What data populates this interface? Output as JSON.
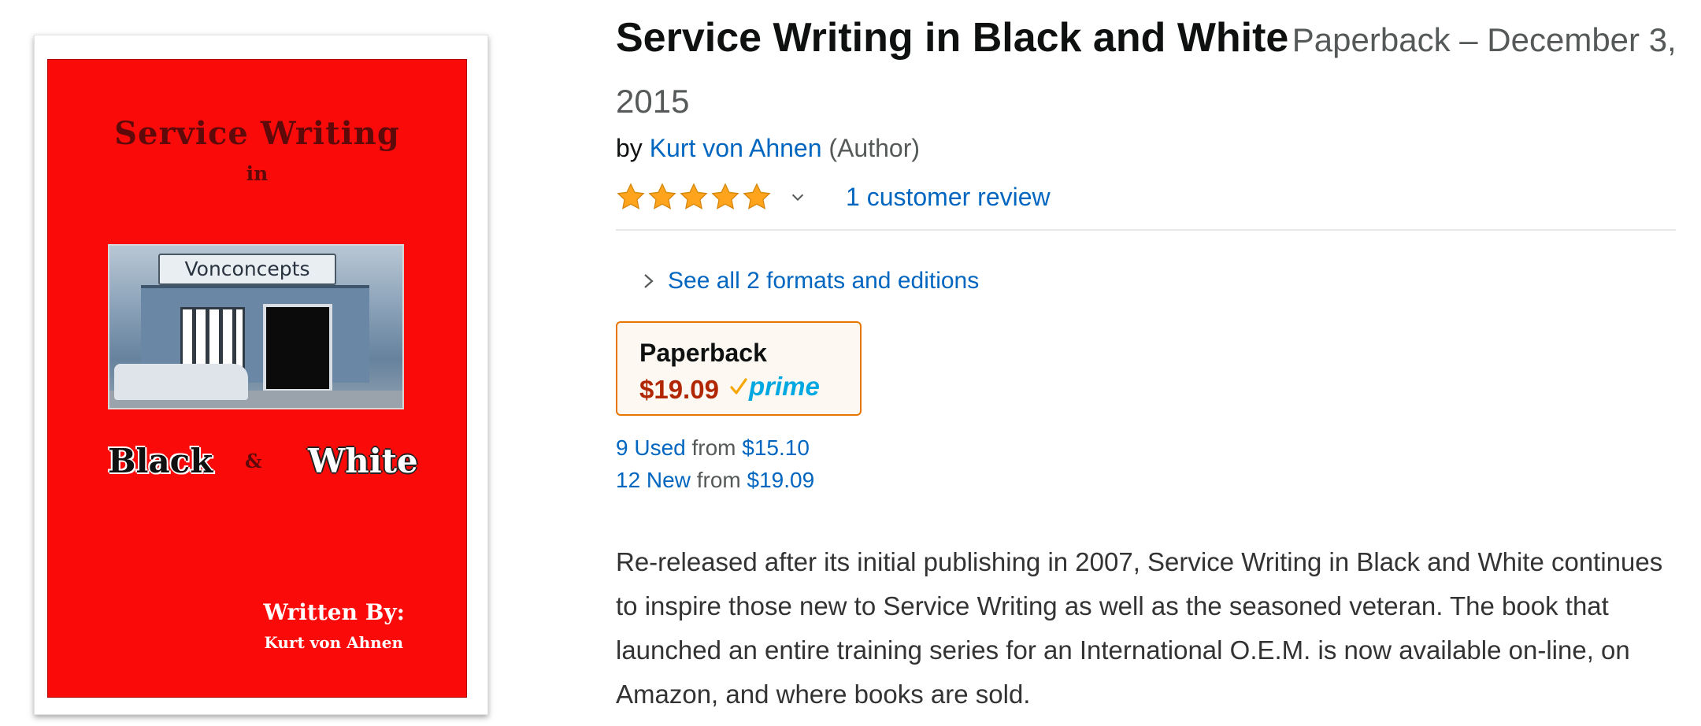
{
  "cover": {
    "title": "Service Writing",
    "in": "in",
    "photo_sign": "Vonconcepts",
    "word_black": "Black",
    "ampersand": "&",
    "word_white": "White",
    "written_by": "Written By:",
    "author": "Kurt von Ahnen",
    "colors": {
      "background": "#fb0a0a",
      "title": "#5e0a0a"
    }
  },
  "product": {
    "title": "Service Writing in Black and White",
    "format_date": "Paperback – December 3, 2015",
    "by_label": "by",
    "author": "Kurt von Ahnen",
    "author_role": "(Author)",
    "rating": {
      "stars": 5,
      "max": 5,
      "icon": "star-icon"
    },
    "review_link": "1 customer review",
    "formats_link": "See all 2 formats and editions"
  },
  "format_swatch": {
    "label": "Paperback",
    "price": "$19.09",
    "badge": "prime",
    "colors": {
      "border": "#e77600",
      "price": "#b12704",
      "prime": "#00a8e1",
      "check": "#f7a600"
    }
  },
  "offers": [
    {
      "count_label": "9 Used",
      "from_label": "from",
      "price": "$15.10"
    },
    {
      "count_label": "12 New",
      "from_label": "from",
      "price": "$19.09"
    }
  ],
  "description": "Re-released after its initial publishing in 2007, Service Writing in Black and White continues to inspire those new to Service Writing as well as the seasoned veteran. The book that launched an entire training series for an International O.E.M. is now available on-line, on Amazon, and where books are sold.",
  "colors": {
    "link": "#0066c0",
    "star": "#ffa41c",
    "text": "#0f1111",
    "muted": "#565959"
  }
}
